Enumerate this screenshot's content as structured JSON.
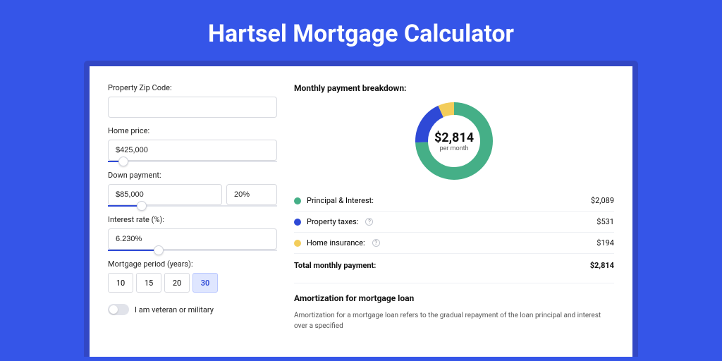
{
  "title": "Hartsel Mortgage Calculator",
  "form": {
    "zip_label": "Property Zip Code:",
    "zip_value": "",
    "price_label": "Home price:",
    "price_value": "$425,000",
    "price_slider_pct": 9,
    "down_label": "Down payment:",
    "down_value": "$85,000",
    "down_pct": "20%",
    "down_slider_pct": 20,
    "rate_label": "Interest rate (%):",
    "rate_value": "6.230%",
    "rate_slider_pct": 30,
    "period_label": "Mortgage period (years):",
    "periods": [
      "10",
      "15",
      "20",
      "30"
    ],
    "period_active": "30",
    "veteran_label": "I am veteran or military"
  },
  "breakdown": {
    "title": "Monthly payment breakdown:",
    "center_amount": "$2,814",
    "center_sub": "per month",
    "items": [
      {
        "label": "Principal & Interest:",
        "amount": "$2,089",
        "color": "#45af87",
        "info": false
      },
      {
        "label": "Property taxes:",
        "amount": "$531",
        "color": "#2e49d6",
        "info": true
      },
      {
        "label": "Home insurance:",
        "amount": "$194",
        "color": "#f3cd5b",
        "info": true
      }
    ],
    "total_label": "Total monthly payment:",
    "total_amount": "$2,814"
  },
  "amort": {
    "title": "Amortization for mortgage loan",
    "body": "Amortization for a mortgage loan refers to the gradual repayment of the loan principal and interest over a specified"
  },
  "chart_data": {
    "type": "pie",
    "title": "Monthly payment breakdown",
    "series": [
      {
        "name": "Principal & Interest",
        "value": 2089,
        "color": "#45af87"
      },
      {
        "name": "Property taxes",
        "value": 531,
        "color": "#2e49d6"
      },
      {
        "name": "Home insurance",
        "value": 194,
        "color": "#f3cd5b"
      }
    ],
    "total": 2814,
    "unit": "USD/month"
  }
}
